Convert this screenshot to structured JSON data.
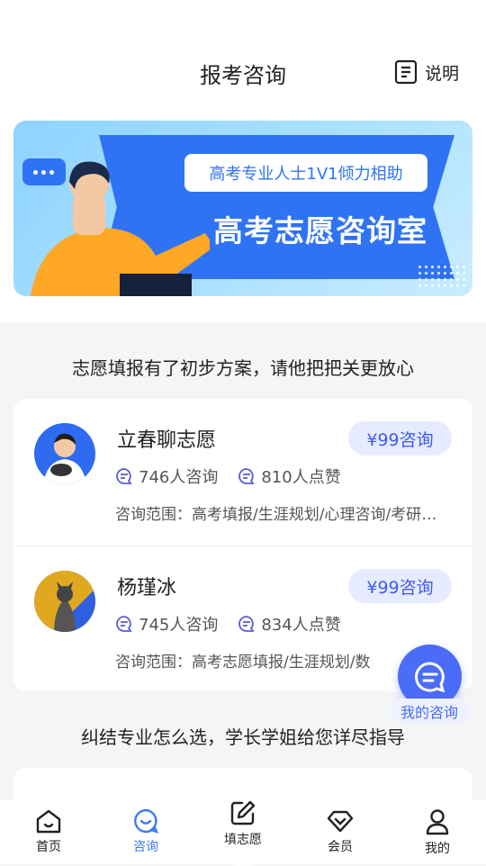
{
  "header": {
    "title": "报考咨询",
    "explain_label": "说明"
  },
  "banner": {
    "tag_text": "高考专业人士1V1倾力相助",
    "main_text": "高考志愿咨询室"
  },
  "sections": [
    {
      "title": "志愿填报有了初步方案，请他把把关更放心"
    },
    {
      "title": "纠结专业怎么选，学长学姐给您详尽指导"
    }
  ],
  "consultants": [
    {
      "name": "立春聊志愿",
      "price": "¥99咨询",
      "consult_count": "746人咨询",
      "like_count": "810人点赞",
      "scope": "咨询范围：高考填报/生涯规划/心理咨询/考研规划"
    },
    {
      "name": "杨瑾冰",
      "price": "¥99咨询",
      "consult_count": "745人咨询",
      "like_count": "834人点赞",
      "scope": "咨询范围：高考志愿填报/生涯规划/数"
    }
  ],
  "fab": {
    "label": "我的咨询"
  },
  "tabbar": {
    "items": [
      {
        "label": "首页",
        "icon": "home-icon"
      },
      {
        "label": "咨询",
        "icon": "consult-icon",
        "active": true
      },
      {
        "label": "填志愿",
        "icon": "edit-icon"
      },
      {
        "label": "会员",
        "icon": "diamond-icon"
      },
      {
        "label": "我的",
        "icon": "user-icon"
      }
    ]
  },
  "colors": {
    "accent": "#3d5bf5",
    "tab_active": "#3d7bf7",
    "banner_blue": "#2f73f4"
  }
}
